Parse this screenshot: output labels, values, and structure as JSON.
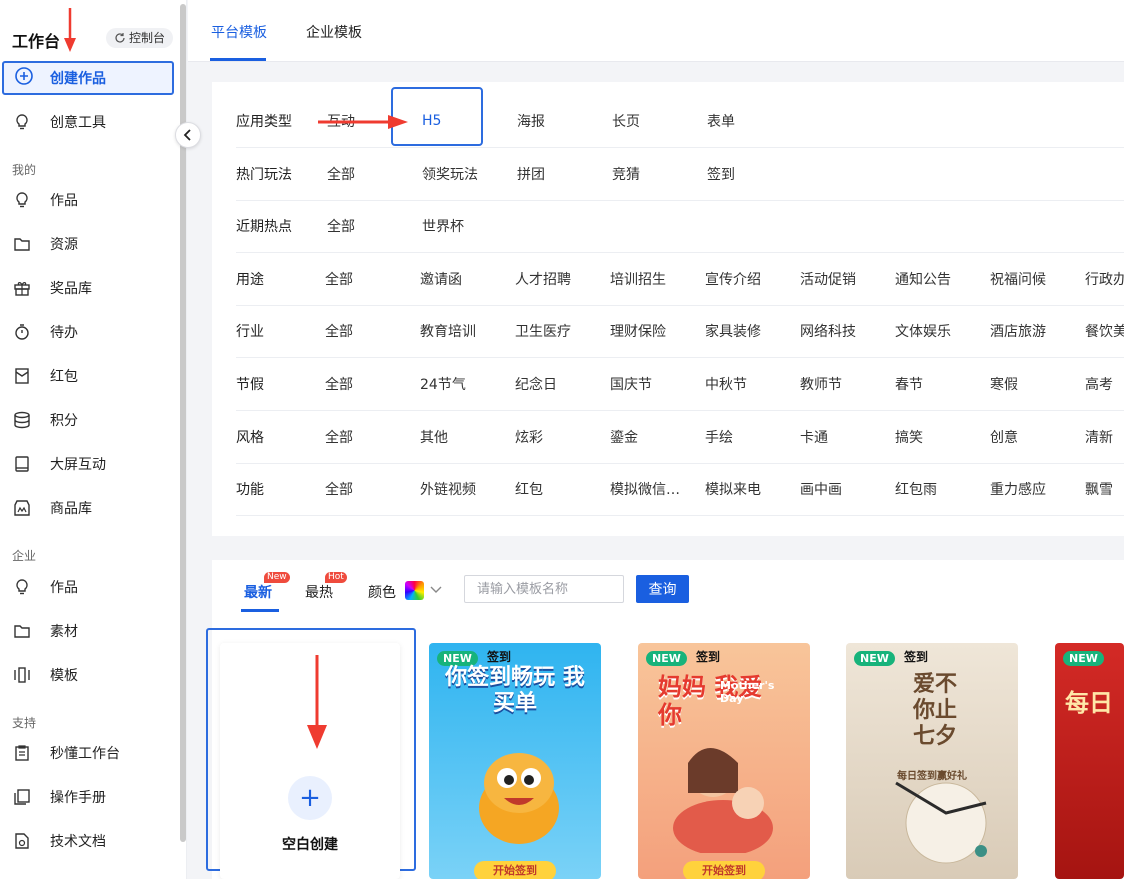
{
  "sidebar": {
    "title": "工作台",
    "console_label": "控制台",
    "create_label": "创建作品",
    "creative_tools_label": "创意工具",
    "section_mine": "我的",
    "mine_items": [
      "作品",
      "资源",
      "奖品库",
      "待办",
      "红包",
      "积分",
      "大屏互动",
      "商品库"
    ],
    "section_enterprise": "企业",
    "enterprise_items": [
      "作品",
      "素材",
      "模板"
    ],
    "section_support": "支持",
    "support_items": [
      "秒懂工作台",
      "操作手册",
      "技术文档"
    ]
  },
  "top_tabs": [
    "平台模板",
    "企业模板"
  ],
  "filters": [
    {
      "label": "应用类型",
      "options": [
        "互动",
        "H5",
        "海报",
        "长页",
        "表单"
      ]
    },
    {
      "label": "热门玩法",
      "options": [
        "全部",
        "领奖玩法",
        "拼团",
        "竞猜",
        "签到"
      ]
    },
    {
      "label": "近期热点",
      "options": [
        "全部",
        "世界杯"
      ]
    },
    {
      "label": "用途",
      "options": [
        "全部",
        "邀请函",
        "人才招聘",
        "培训招生",
        "宣传介绍",
        "活动促销",
        "通知公告",
        "祝福问候",
        "行政办"
      ]
    },
    {
      "label": "行业",
      "options": [
        "全部",
        "教育培训",
        "卫生医疗",
        "理财保险",
        "家具装修",
        "网络科技",
        "文体娱乐",
        "酒店旅游",
        "餐饮美"
      ]
    },
    {
      "label": "节假",
      "options": [
        "全部",
        "24节气",
        "纪念日",
        "国庆节",
        "中秋节",
        "教师节",
        "春节",
        "寒假",
        "高考"
      ]
    },
    {
      "label": "风格",
      "options": [
        "全部",
        "其他",
        "炫彩",
        "鎏金",
        "手绘",
        "卡通",
        "搞笑",
        "创意",
        "清新"
      ]
    },
    {
      "label": "功能",
      "options": [
        "全部",
        "外链视频",
        "红包",
        "模拟微信…",
        "模拟来电",
        "画中画",
        "红包雨",
        "重力感应",
        "飘雪"
      ]
    }
  ],
  "sort_tabs": {
    "latest": "最新",
    "latest_badge": "New",
    "hot": "最热",
    "hot_badge": "Hot",
    "color_label": "颜色"
  },
  "search": {
    "placeholder": "请输入模板名称",
    "button": "查询"
  },
  "blank_card": {
    "label": "空白创建"
  },
  "templates": [
    {
      "tag": "NEW",
      "category": "签到",
      "title": "你签到畅玩 我买单",
      "cta": "开始签到",
      "colors": [
        "#2fb4f0",
        "#7ad2f7"
      ]
    },
    {
      "tag": "NEW",
      "category": "签到",
      "title": "妈妈 我爱你",
      "subtitle": "Mother's Day",
      "cta": "开始签到",
      "colors": [
        "#f8c59a",
        "#f4a07c"
      ]
    },
    {
      "tag": "NEW",
      "category": "签到",
      "title": "爱不你止七夕",
      "subtitle": "每日签到赢好礼",
      "colors": [
        "#efe6d8",
        "#d9cbb7"
      ]
    },
    {
      "tag": "NEW",
      "title": "每日",
      "colors": [
        "#d42a26",
        "#a51411"
      ]
    }
  ]
}
